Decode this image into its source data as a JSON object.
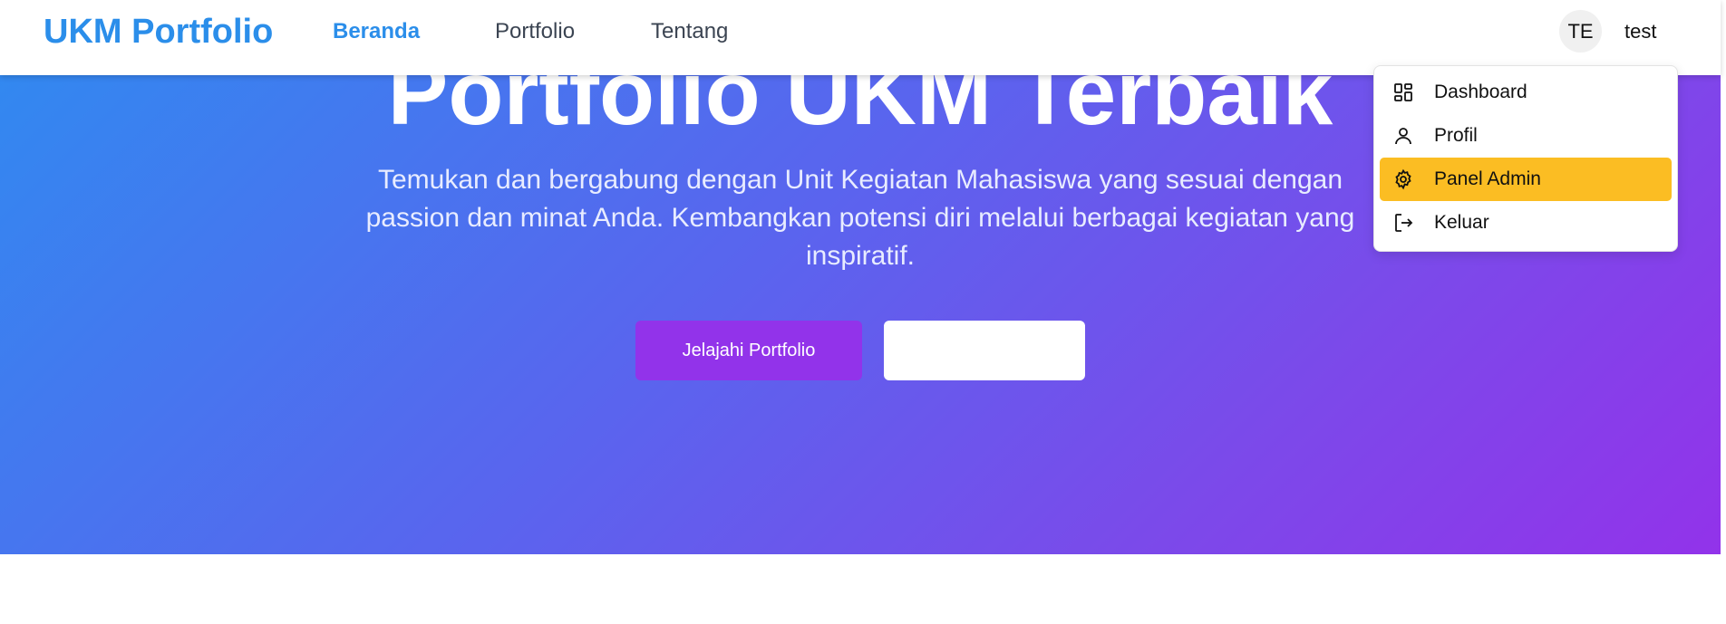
{
  "navbar": {
    "brand": "UKM Portfolio",
    "links": [
      {
        "label": "Beranda",
        "active": true
      },
      {
        "label": "Portfolio",
        "active": false
      },
      {
        "label": "Tentang",
        "active": false
      }
    ],
    "avatar_initials": "TE",
    "username": "test"
  },
  "dropdown": {
    "items": [
      {
        "label": "Dashboard",
        "icon": "dashboard-icon"
      },
      {
        "label": "Profil",
        "icon": "user-icon"
      },
      {
        "label": "Panel Admin",
        "icon": "gear-icon",
        "highlighted": true
      },
      {
        "label": "Keluar",
        "icon": "logout-icon"
      }
    ]
  },
  "hero": {
    "title": "Portfolio UKM Terbaik",
    "subtitle": "Temukan dan bergabung dengan Unit Kegiatan Mahasiswa yang sesuai dengan passion dan minat Anda. Kembangkan potensi diri melalui berbagai kegiatan yang inspiratif.",
    "primary_button": "Jelajahi Portfolio",
    "secondary_button": ""
  },
  "colors": {
    "brand": "#2b8eea",
    "hero_gradient_start": "#2f8bf0",
    "hero_gradient_end": "#9233ea",
    "primary_button": "#9233ea",
    "menu_highlight": "#fbbd23"
  }
}
